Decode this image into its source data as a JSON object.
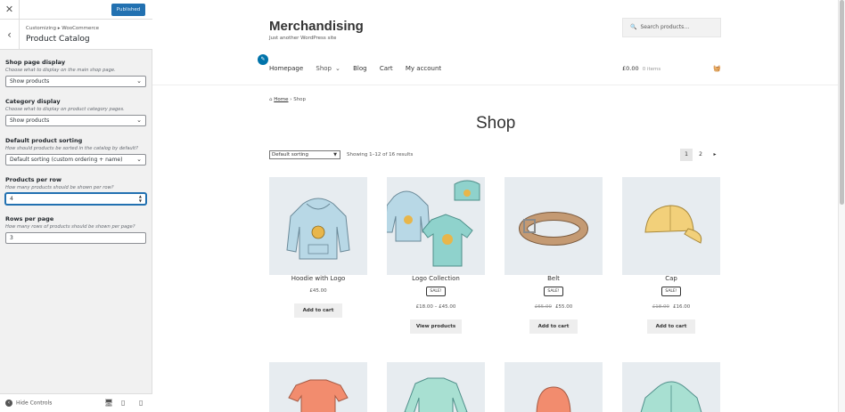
{
  "customizer": {
    "close_icon": "close-icon",
    "publish_label": "Published",
    "breadcrumb": "Customizing ▸ WooCommerce",
    "section_title": "Product Catalog",
    "controls": [
      {
        "label": "Shop page display",
        "description": "Choose what to display on the main shop page.",
        "value": "Show products"
      },
      {
        "label": "Category display",
        "description": "Choose what to display on product category pages.",
        "value": "Show products"
      },
      {
        "label": "Default product sorting",
        "description": "How should products be sorted in the catalog by default?",
        "value": "Default sorting (custom ordering + name)"
      },
      {
        "label": "Products per row",
        "description": "How many products should be shown per row?",
        "value": "4"
      },
      {
        "label": "Rows per page",
        "description": "How many rows of products should be shown per page?",
        "value": "3"
      }
    ],
    "hide_controls_label": "Hide Controls",
    "devices": [
      "desktop",
      "tablet",
      "mobile"
    ],
    "accent_color": "#2271b1"
  },
  "site": {
    "title": "Merchandising",
    "tagline": "Just another WordPress site",
    "search_placeholder": "Search products…",
    "nav": [
      "Homepage",
      "Shop",
      "Blog",
      "Cart",
      "My account"
    ],
    "cart_total": "£0.00",
    "cart_items": "0 items"
  },
  "shop": {
    "breadcrumb_home": "Home",
    "breadcrumb_current": "Shop",
    "title": "Shop",
    "sorting_value": "Default sorting",
    "result_count": "Showing 1–12 of 16 results",
    "pages": [
      "1",
      "2"
    ],
    "current_page": "1",
    "products": [
      {
        "name": "Hoodie with Logo",
        "sale": "",
        "old_price": "",
        "price": "£45.00",
        "button": "Add to cart"
      },
      {
        "name": "Logo Collection",
        "sale": "SALE!",
        "old_price": "",
        "price": "£18.00 – £45.00",
        "button": "View products"
      },
      {
        "name": "Belt",
        "sale": "SALE!",
        "old_price": "£65.00",
        "price": "£55.00",
        "button": "Add to cart"
      },
      {
        "name": "Cap",
        "sale": "SALE!",
        "old_price": "£18.00",
        "price": "£16.00",
        "button": "Add to cart"
      }
    ]
  }
}
